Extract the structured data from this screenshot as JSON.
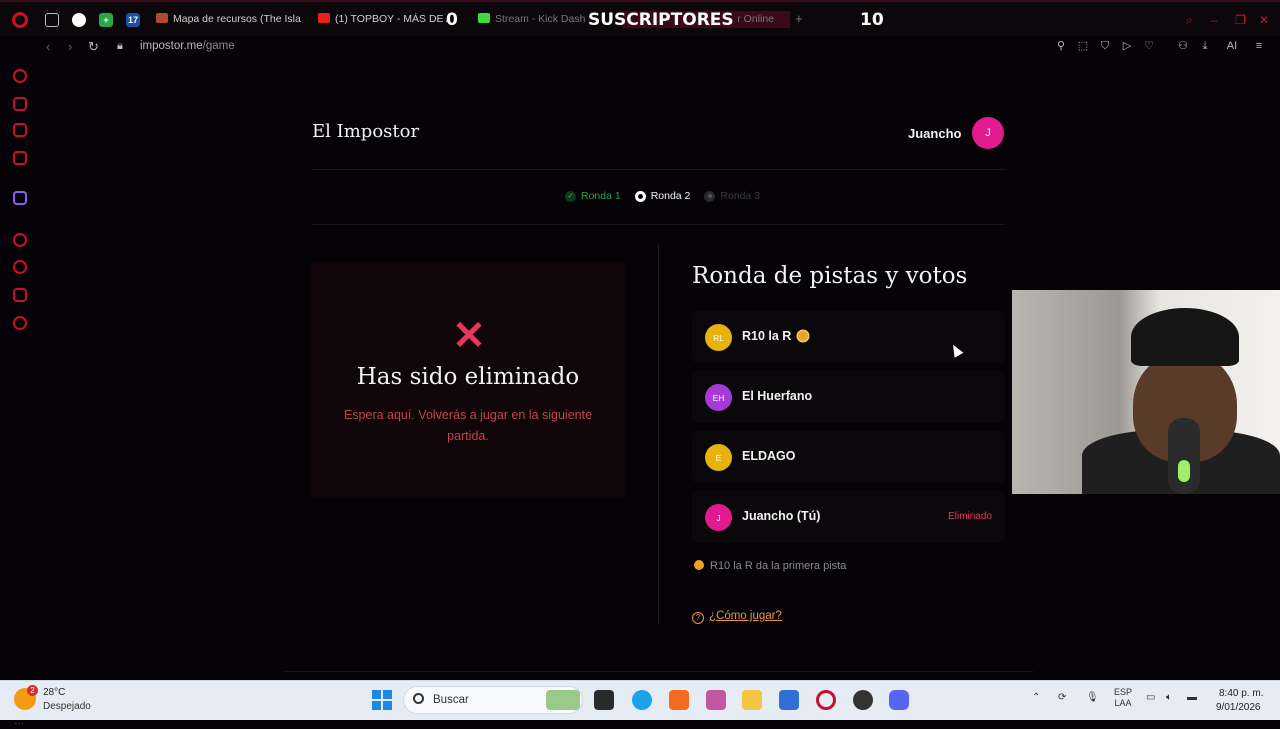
{
  "browser": {
    "tabs": [
      {
        "label": "Mapa de recursos (The Isla",
        "color": "#b04a2e"
      },
      {
        "label": "(1) TOPBOY - MÁS DE A",
        "color": "#e62117"
      },
      {
        "label": "Stream - Kick Dashb",
        "color": "#3ddc3d"
      },
      {
        "label": "r Online",
        "color": "#555555"
      }
    ],
    "url_host": "impostor.me",
    "url_path": "/game",
    "ai_label": "AI"
  },
  "overlay": {
    "left_number": "0",
    "label": "SUSCRIPTORES",
    "right_number": "10"
  },
  "app": {
    "title": "El Impostor",
    "user": {
      "name": "Juancho",
      "initial": "J",
      "color": "#e3198f"
    }
  },
  "rounds": [
    {
      "label": "Ronda 1",
      "state": "done"
    },
    {
      "label": "Ronda 2",
      "state": "current"
    },
    {
      "label": "Ronda 3",
      "state": "upcoming"
    }
  ],
  "eliminated": {
    "icon": "✕",
    "title": "Has sido eliminado",
    "subtitle": "Espera aquí. Volverás a jugar en la siguiente partida."
  },
  "game": {
    "title": "Ronda de pistas y votos",
    "players": [
      {
        "initials": "RL",
        "name": "R10 la R",
        "color": "#e8b20c",
        "current_turn": true,
        "status": ""
      },
      {
        "initials": "EH",
        "name": "El Huerfano",
        "color": "#a53ad6",
        "current_turn": false,
        "status": ""
      },
      {
        "initials": "E",
        "name": "ELDAGO",
        "color": "#e8b20c",
        "current_turn": false,
        "status": ""
      },
      {
        "initials": "J",
        "name": "Juancho (Tú)",
        "color": "#e3198f",
        "current_turn": false,
        "status": "Eliminado"
      }
    ],
    "hint": "R10 la R da la primera pista",
    "how_to_play": "¿Cómo jugar?"
  },
  "taskbar": {
    "temperature": "28°C",
    "condition": "Despejado",
    "weather_badge": "2",
    "search_placeholder": "Buscar",
    "lang_top": "ESP",
    "lang_bottom": "LAA",
    "time": "8:40 p. m.",
    "date": "9/01/2026"
  }
}
